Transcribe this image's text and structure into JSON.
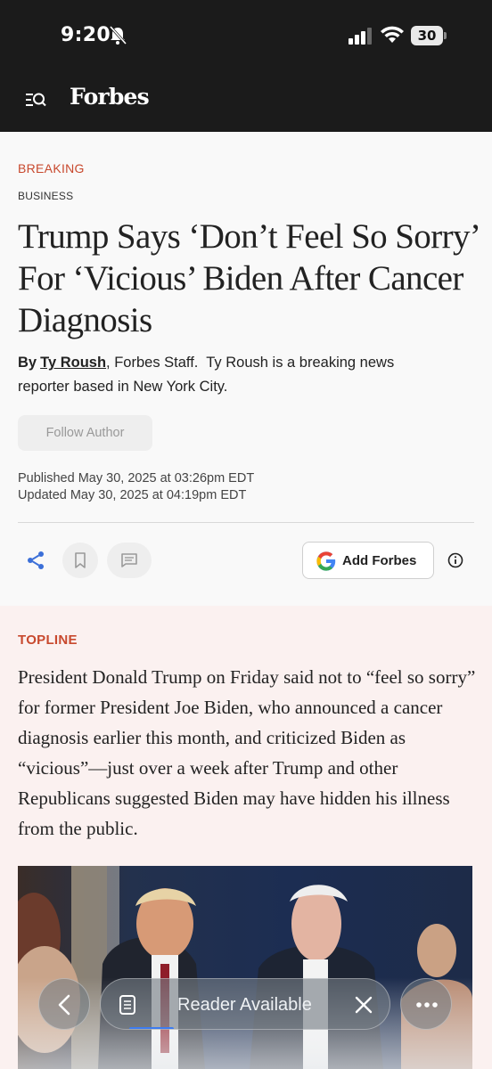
{
  "status_bar": {
    "time": "9:20",
    "battery": "30",
    "icons": [
      "bell-off-icon",
      "cellular-signal-icon",
      "wifi-icon",
      "battery-icon"
    ]
  },
  "header": {
    "brand": "Forbes",
    "menu_icon": "menu-search-icon"
  },
  "article": {
    "label": "BREAKING",
    "section": "BUSINESS",
    "headline": "Trump Says ‘Don’t Feel So Sorry’ For ‘Vicious’ Biden After Cancer Diagnosis",
    "byline": {
      "by": "By",
      "author": "Ty Roush",
      "affiliation": ", Forbes Staff.",
      "bio": "Ty Roush is a breaking news reporter based in New York City."
    },
    "follow_label": "Follow Author",
    "published": "Published May 30, 2025 at 03:26pm EDT",
    "updated": "Updated May 30, 2025 at 04:19pm EDT"
  },
  "actions": {
    "icons": [
      "share-icon",
      "bookmark-icon",
      "comment-icon",
      "info-icon"
    ],
    "add_forbes_label": "Add Forbes"
  },
  "topline": {
    "label": "TOPLINE",
    "text": "President Donald Trump on Friday said not to “feel so sorry” for former President Joe Biden, who announced a cancer diagnosis earlier this month, and criticized Biden as “vicious”—just over a week after Trump and other Republicans suggested Biden may have hidden his illness from the public."
  },
  "browser_bar": {
    "reader_label": "Reader Available",
    "icons": [
      "back-chevron-icon",
      "reader-icon",
      "close-icon",
      "more-icon"
    ]
  },
  "colors": {
    "header_bg": "#1b1b1b",
    "accent_red": "#c8492e",
    "topline_bg": "#fbf1f0",
    "share_blue": "#3b6fd8"
  }
}
